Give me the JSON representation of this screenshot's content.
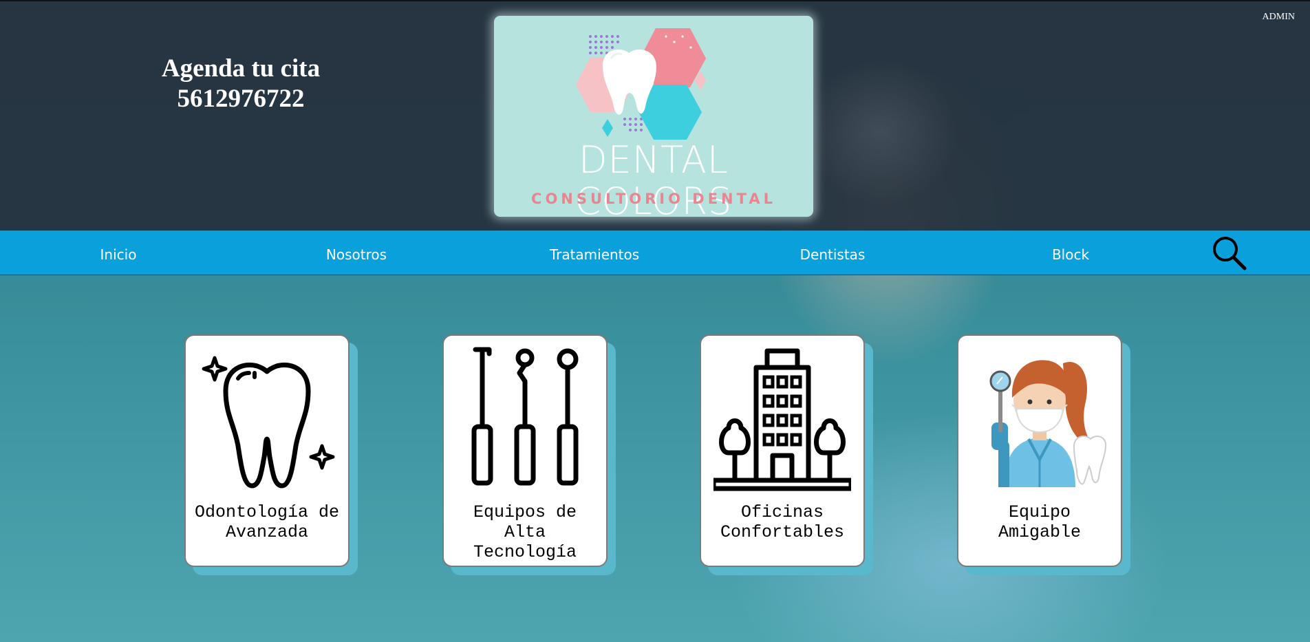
{
  "header": {
    "agenda_line1": "Agenda tu cita",
    "agenda_line2": "5612976722",
    "admin_label": "ADMIN"
  },
  "logo": {
    "title": "DENTAL COLORS",
    "subtitle": "CONSULTORIO DENTAL"
  },
  "nav": {
    "items": [
      {
        "label": "Inicio"
      },
      {
        "label": "Nosotros"
      },
      {
        "label": "Tratamientos"
      },
      {
        "label": "Dentistas"
      },
      {
        "label": "Block"
      }
    ],
    "search_icon": "search-icon"
  },
  "features": [
    {
      "line1": "Odontología de",
      "line2": "Avanzada",
      "line3": "",
      "icon": "tooth-icon"
    },
    {
      "line1": "Equipos de",
      "line2": "Alta",
      "line3": "Tecnología",
      "icon": "dental-tools-icon"
    },
    {
      "line1": "Oficinas",
      "line2": "Confortables",
      "line3": "",
      "icon": "building-icon"
    },
    {
      "line1": "Equipo",
      "line2": "Amigable",
      "line3": "",
      "icon": "dentist-avatar-icon"
    }
  ],
  "colors": {
    "header_bg": "#26303c",
    "nav_bg": "#0aa0dc",
    "logo_bg": "#b7e3df",
    "card_shadow": "#5ab8cc"
  }
}
